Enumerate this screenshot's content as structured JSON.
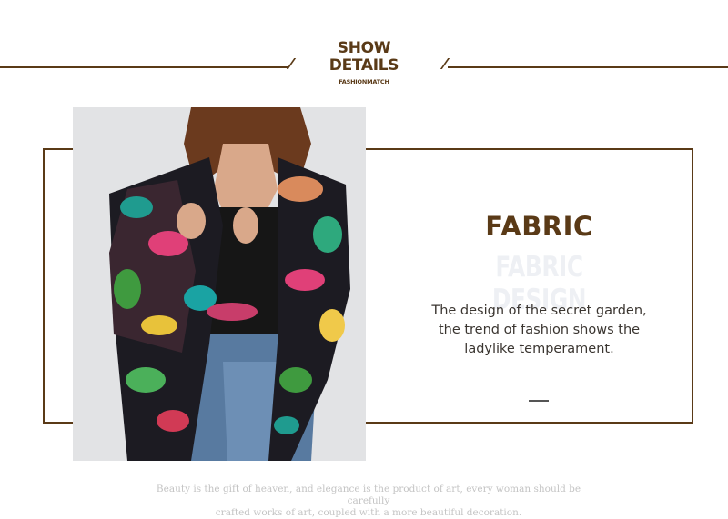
{
  "header": {
    "title_line1": "SHOW",
    "title_line2": "DETAILS",
    "subtitle": "FASHIONMATCH"
  },
  "feature": {
    "title": "FABRIC",
    "watermark": "FABRIC DESIGN",
    "description_line1": "The design of the secret garden,",
    "description_line2": "the trend of fashion shows the",
    "description_line3": "ladylike temperament."
  },
  "footer": {
    "line1": "Beauty is the gift of heaven, and elegance is the product of art, every woman should be carefully",
    "line2": "crafted works of art, coupled with a more beautiful decoration."
  },
  "colors": {
    "accent": "#5a3a17",
    "watermark": "#eef0f4",
    "footer_text": "#c4c4c4"
  }
}
